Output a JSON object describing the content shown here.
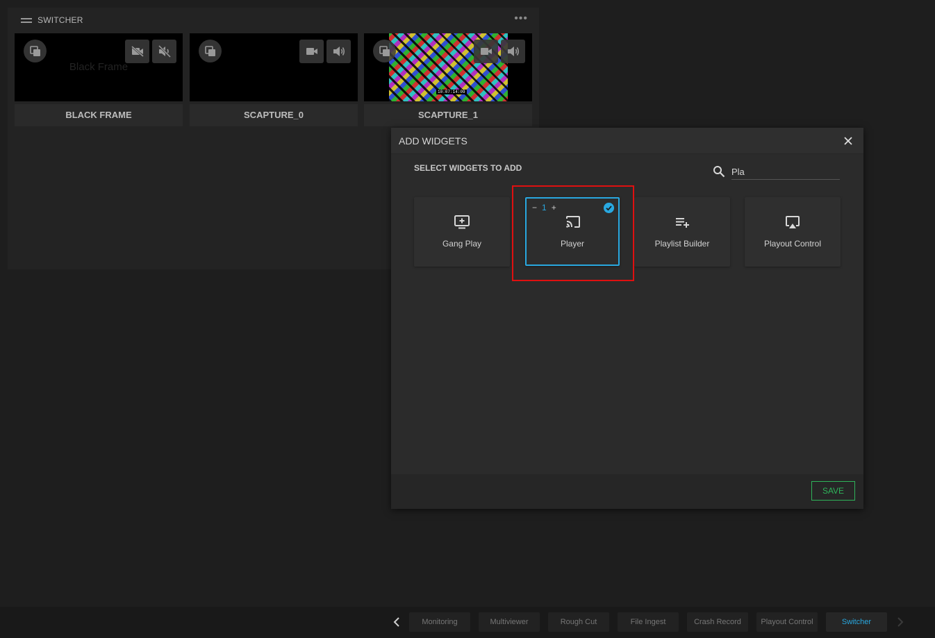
{
  "switcher": {
    "title": "SWITCHER",
    "more": "•••",
    "sources": [
      {
        "label": "BLACK FRAME",
        "overlay_text": "Black Frame",
        "icons": [
          "copy-icon",
          "video-off-icon",
          "volume-off-icon"
        ]
      },
      {
        "label": "SCAPTURE_0",
        "icons": [
          "copy-icon",
          "video-icon",
          "volume-icon"
        ]
      },
      {
        "label": "SCAPTURE_1",
        "timestamp": "10:07:14:09",
        "icons": [
          "copy-icon",
          "video-icon",
          "volume-icon"
        ]
      }
    ]
  },
  "dialog": {
    "title": "ADD WIDGETS",
    "subtitle": "SELECT WIDGETS TO ADD",
    "search_value": "Pla",
    "widgets": [
      {
        "label": "Gang Play",
        "icon": "add-to-screen-icon",
        "selected": false
      },
      {
        "label": "Player",
        "icon": "cast-icon",
        "selected": true,
        "quantity": "1",
        "minus": "−",
        "plus": "+"
      },
      {
        "label": "Playlist Builder",
        "icon": "playlist-add-icon",
        "selected": false
      },
      {
        "label": "Playout Control",
        "icon": "airplay-icon",
        "selected": false
      }
    ],
    "save_label": "SAVE"
  },
  "bottom_bar": {
    "tabs": [
      {
        "label": "Monitoring",
        "active": false
      },
      {
        "label": "Multiviewer",
        "active": false
      },
      {
        "label": "Rough Cut",
        "active": false
      },
      {
        "label": "File Ingest",
        "active": false
      },
      {
        "label": "Crash Record",
        "active": false
      },
      {
        "label": "Playout Control",
        "active": false
      },
      {
        "label": "Switcher",
        "active": true
      }
    ]
  },
  "colors": {
    "accent": "#29a8e0",
    "save": "#2fb35a",
    "highlight": "#e01010"
  }
}
